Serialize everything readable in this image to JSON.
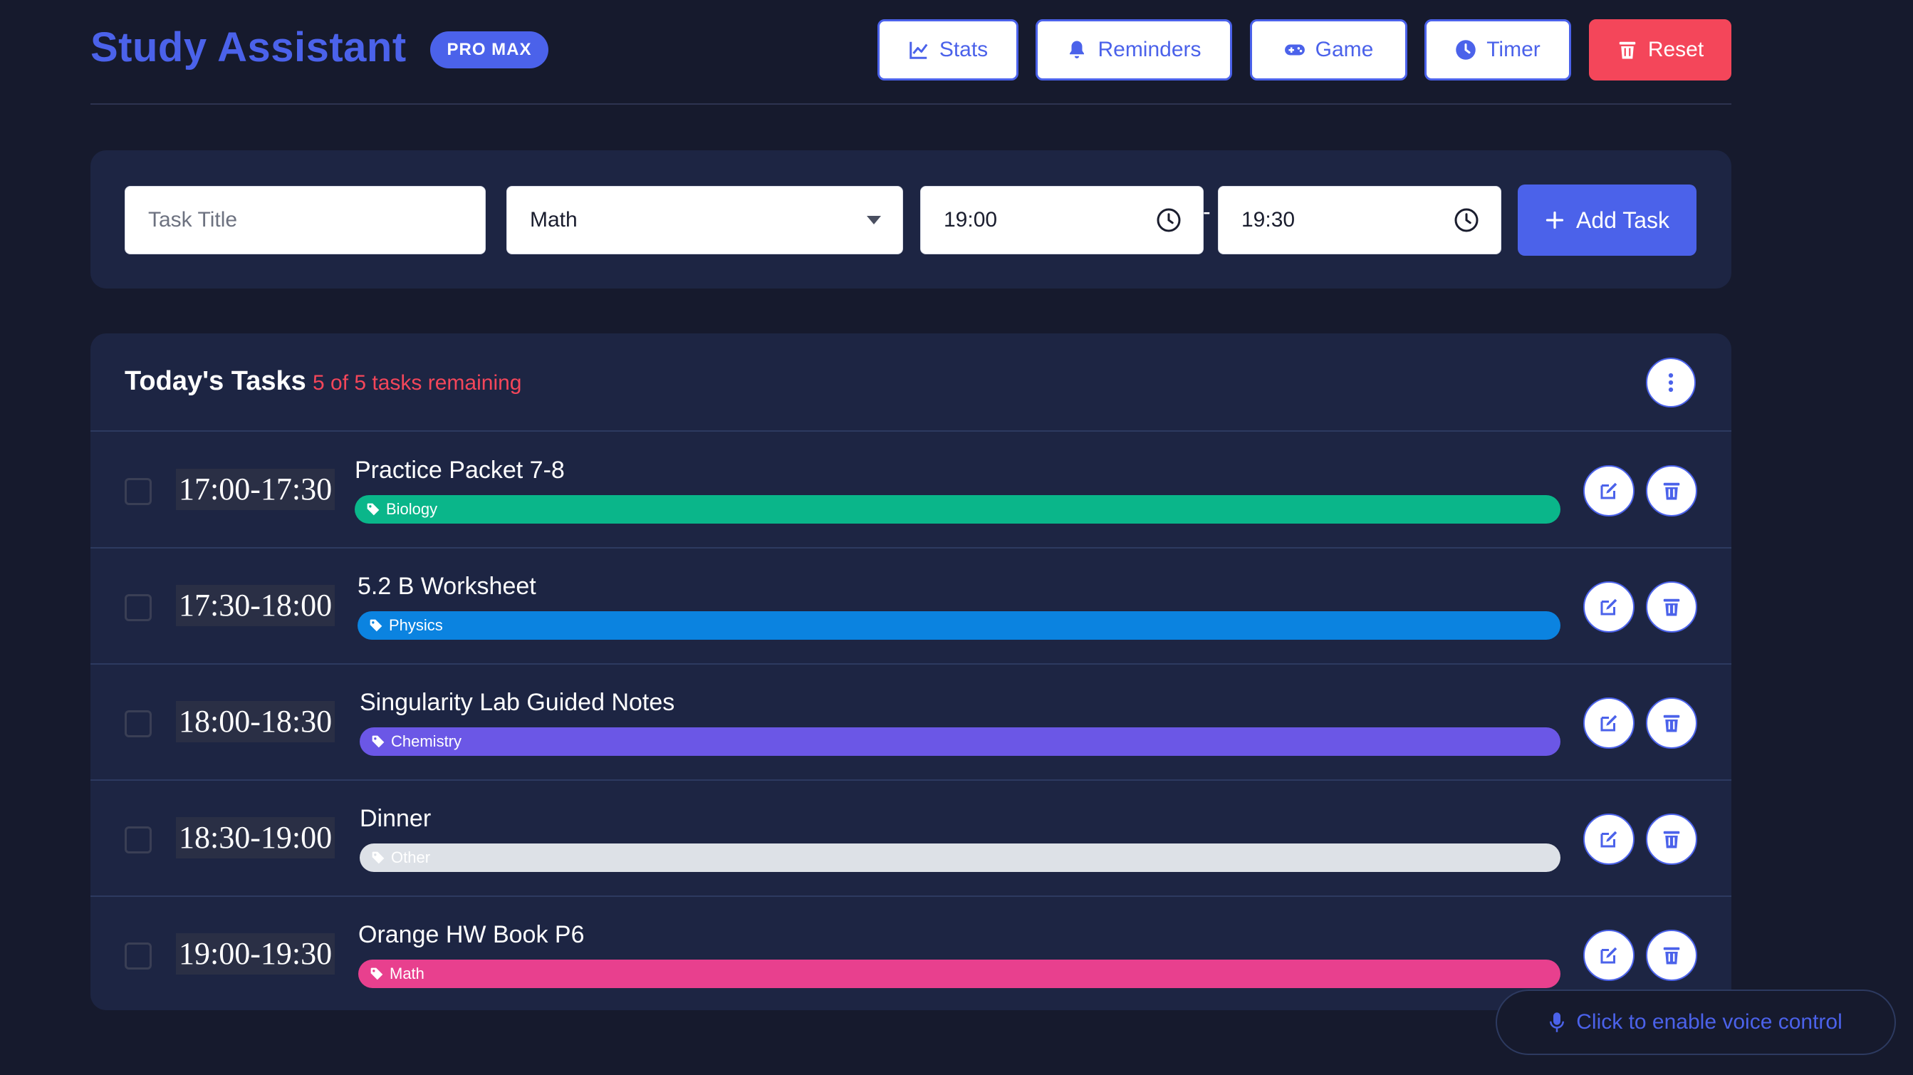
{
  "header": {
    "title": "Study Assistant",
    "badge": "PRO MAX",
    "buttons": {
      "stats": "Stats",
      "reminders": "Reminders",
      "game": "Game",
      "timer": "Timer",
      "reset": "Reset"
    }
  },
  "form": {
    "title_placeholder": "Task Title",
    "subject_selected": "Math",
    "start_time": "19:00",
    "end_time": "19:30",
    "separator": "-",
    "add_label": "Add Task"
  },
  "tasks": {
    "heading": "Today's Tasks",
    "remaining": "5 of 5 tasks remaining",
    "items": [
      {
        "time": "17:00-17:30",
        "title": "Practice Packet 7-8",
        "tag": "Biology",
        "color": "#0ab68a"
      },
      {
        "time": "17:30-18:00",
        "title": "5.2 B Worksheet",
        "tag": "Physics",
        "color": "#0b83e0"
      },
      {
        "time": "18:00-18:30",
        "title": "Singularity Lab Guided Notes",
        "tag": "Chemistry",
        "color": "#6b57e6"
      },
      {
        "time": "18:30-19:00",
        "title": "Dinner",
        "tag": "Other",
        "color": "#dde1e7"
      },
      {
        "time": "19:00-19:30",
        "title": "Orange HW Book P6",
        "tag": "Math",
        "color": "#e8408e"
      }
    ]
  },
  "voice": {
    "label": "Click to enable voice control"
  },
  "colors": {
    "accent": "#4b62ea",
    "danger": "#f4465a",
    "background": "#161a2d",
    "panel": "#1d2543"
  }
}
